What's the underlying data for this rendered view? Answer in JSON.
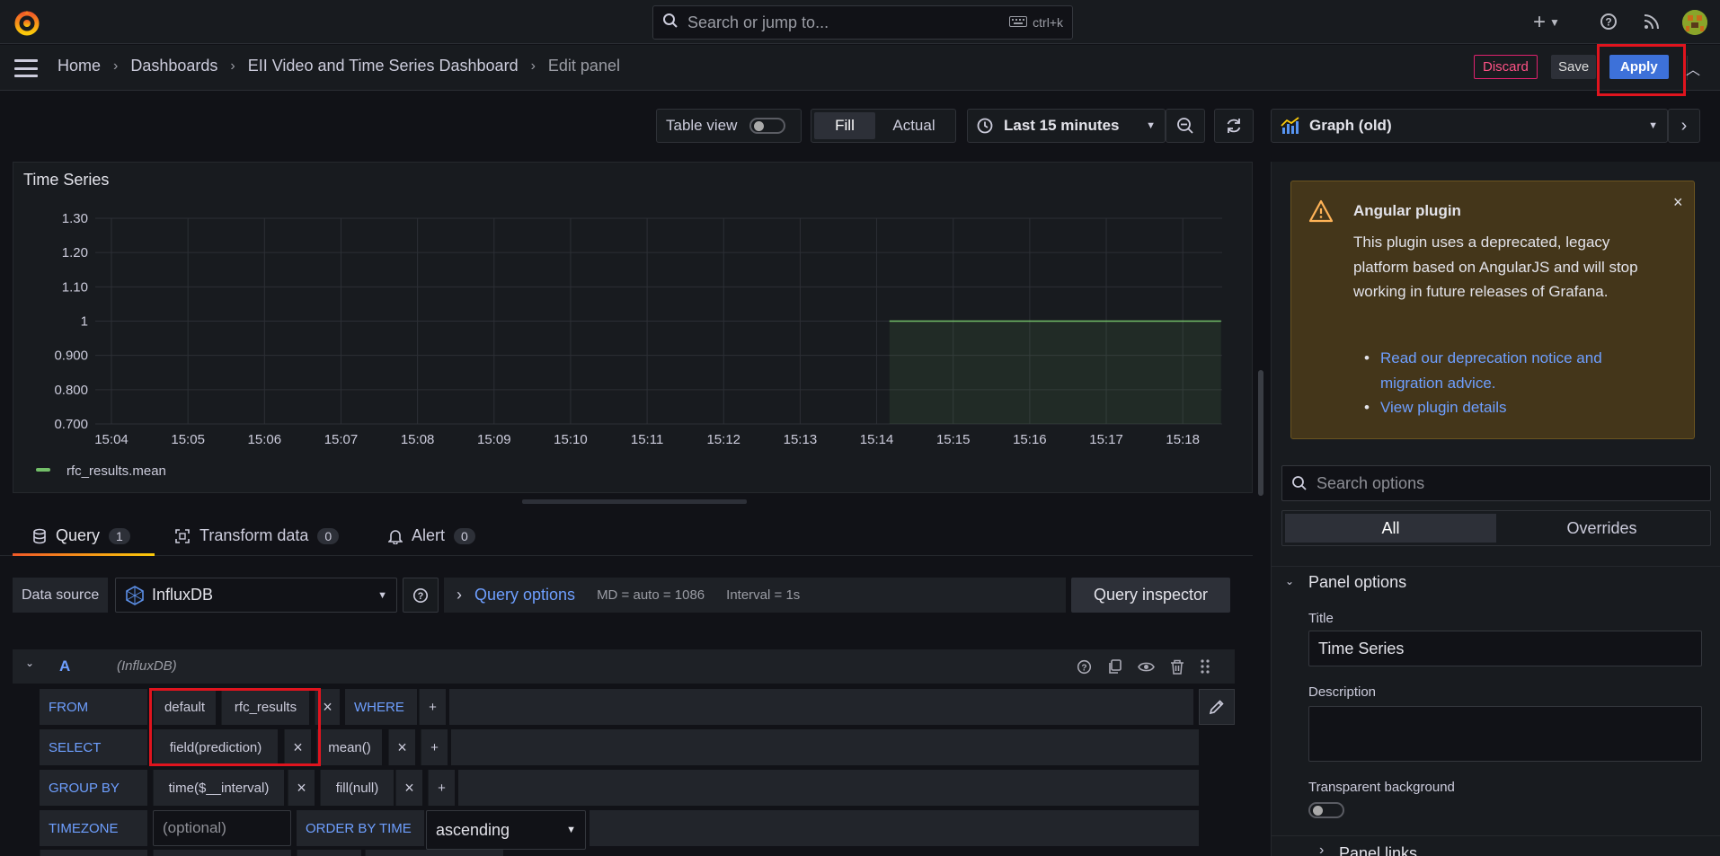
{
  "topbar": {
    "search_placeholder": "Search or jump to...",
    "search_shortcut": "ctrl+k",
    "plus_icon": "plus-icon",
    "help_icon": "help-icon",
    "news_icon": "rss-icon"
  },
  "breadcrumb": {
    "home": "Home",
    "dashboards": "Dashboards",
    "dashboard": "EII Video and Time Series Dashboard",
    "current": "Edit panel"
  },
  "actions": {
    "discard": "Discard",
    "save": "Save",
    "apply": "Apply"
  },
  "toolbar": {
    "table_view": "Table view",
    "fill": "Fill",
    "actual": "Actual",
    "time_range": "Last 15 minutes",
    "visualization": "Graph (old)"
  },
  "panel": {
    "title": "Time Series"
  },
  "chart_data": {
    "type": "line",
    "title": "Time Series",
    "yticks": [
      "1.30",
      "1.20",
      "1.10",
      "1",
      "0.900",
      "0.800",
      "0.700"
    ],
    "ylim": [
      0.7,
      1.3
    ],
    "xticks": [
      "15:04",
      "15:05",
      "15:06",
      "15:07",
      "15:08",
      "15:09",
      "15:10",
      "15:11",
      "15:12",
      "15:13",
      "15:14",
      "15:15",
      "15:16",
      "15:17",
      "15:18"
    ],
    "series": [
      {
        "name": "rfc_results.mean",
        "color": "#73bf69",
        "x_start": "15:14:10",
        "x_end": "15:18:30",
        "value": 1
      }
    ],
    "legend": "bottom-left",
    "grid": true
  },
  "tabs": [
    {
      "label": "Query",
      "count": "1",
      "icon": "database-icon"
    },
    {
      "label": "Transform data",
      "count": "0",
      "icon": "transform-icon"
    },
    {
      "label": "Alert",
      "count": "0",
      "icon": "bell-icon"
    }
  ],
  "datasource": {
    "label": "Data source",
    "name": "InfluxDB",
    "query_options": "Query options",
    "md": "MD = auto = 1086",
    "interval": "Interval = 1s",
    "inspector": "Query inspector"
  },
  "query": {
    "ref": "A",
    "source": "(InfluxDB)",
    "from_label": "FROM",
    "from_db": "default",
    "from_measurement": "rfc_results",
    "where_label": "WHERE",
    "select_label": "SELECT",
    "select_field": "field(prediction)",
    "select_fn": "mean()",
    "groupby_label": "GROUP BY",
    "groupby_time": "time($__interval)",
    "groupby_fill": "fill(null)",
    "timezone_label": "TIMEZONE",
    "timezone_placeholder": "(optional)",
    "orderby_label": "ORDER BY TIME",
    "orderby_value": "ascending",
    "plus": "+",
    "remove": "×"
  },
  "options": {
    "warning_title": "Angular plugin",
    "warning_text": "This plugin uses a deprecated, legacy platform based on AngularJS and will stop working in future releases of Grafana.",
    "warning_link1": "Read our deprecation notice and migration advice.",
    "warning_link2": "View plugin details",
    "search_placeholder": "Search options",
    "tab_all": "All",
    "tab_overrides": "Overrides",
    "section": "Panel options",
    "title_label": "Title",
    "title_value": "Time Series",
    "description_label": "Description",
    "transparent_label": "Transparent background",
    "panel_links": "Panel links"
  }
}
